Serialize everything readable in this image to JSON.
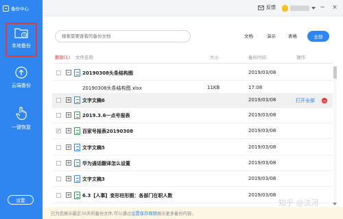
{
  "app": {
    "title": "备份中心"
  },
  "sidebar": {
    "items": [
      {
        "label": "本地备份",
        "icon": "folder-clock-icon",
        "active": true
      },
      {
        "label": "云端备份",
        "icon": "cloud-upload-icon"
      },
      {
        "label": "一键恢复",
        "icon": "hand-tap-icon"
      }
    ],
    "settings_label": "设置"
  },
  "topbar": {
    "feedback_label": "反馈",
    "feedback_icon": "envelope-icon"
  },
  "search": {
    "placeholder": "搜索需要查看的备份文档"
  },
  "filters": [
    "文档",
    "演示",
    "表格",
    "全部"
  ],
  "table": {
    "delete_label": "删除(1)",
    "headers": {
      "name": "文件名称",
      "size": "大小",
      "time": "备份时间",
      "action": "操作"
    },
    "rows": [
      {
        "name": "20190308头条结构图",
        "size": "",
        "time": "2019/03/08",
        "expand": "−",
        "checked": false,
        "icon": "file-doc-icon"
      },
      {
        "name": "20190308头条结构图.xlsx",
        "size": "11KB",
        "time": "17:08",
        "child": true,
        "icon": ""
      },
      {
        "name": "文字文稿6",
        "size": "",
        "time": "2019/03/08",
        "expand": "+",
        "checked": false,
        "icon": "file-doc-icon",
        "action": "打开全部",
        "selected": true
      },
      {
        "name": "2019.3.6一点号报表",
        "size": "",
        "time": "2019/03/08",
        "expand": "+",
        "checked": false,
        "icon": "file-sheet-icon"
      },
      {
        "name": "百家号报表20190308",
        "size": "",
        "time": "2019/03/08",
        "expand": "+",
        "checked": true,
        "icon": "file-sheet-icon"
      },
      {
        "name": "文字文稿5",
        "size": "",
        "time": "2019/03/08",
        "expand": "+",
        "checked": false,
        "icon": "file-doc-icon"
      },
      {
        "name": "华为通话翻译怎么设置",
        "size": "",
        "time": "2019/03/08",
        "expand": "+",
        "checked": false,
        "icon": "file-doc-icon"
      },
      {
        "name": "文字文稿3",
        "size": "",
        "time": "2019/03/08",
        "expand": "+",
        "checked": false,
        "icon": "file-doc-icon"
      },
      {
        "name": "6.3【人事】变形柱形图：各部门在职人数",
        "size": "",
        "time": "2019/03/08",
        "expand": "+",
        "checked": false,
        "icon": "file-sheet-icon"
      }
    ]
  },
  "footer": {
    "text_before": "已为您展示最近30天的备份文件,可以通过",
    "link": "设置保存周期",
    "text_after": "展示更多备份内容。"
  },
  "watermark": "知乎 @泫河",
  "colors": {
    "accent": "#2f86f0",
    "danger": "#e53935",
    "footer_bg": "#fdf6e3"
  }
}
